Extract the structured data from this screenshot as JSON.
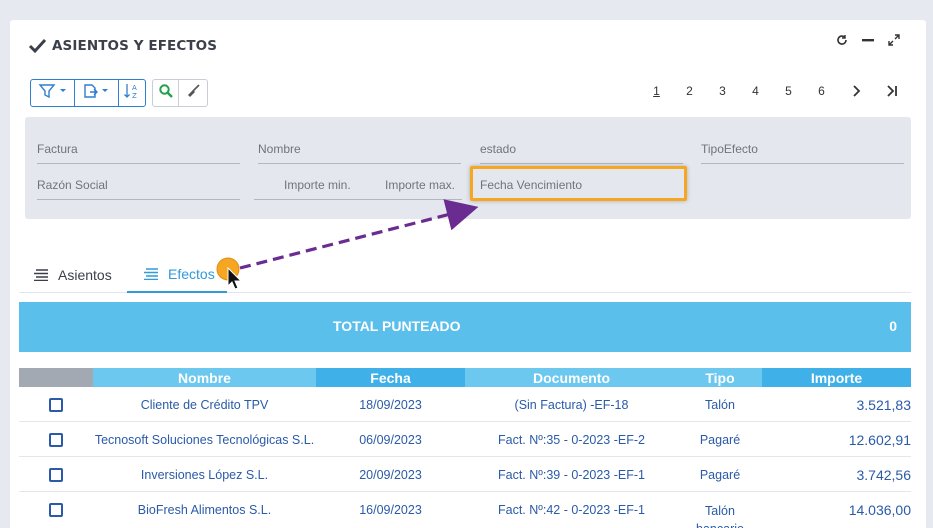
{
  "panel": {
    "title": "ASIENTOS Y EFECTOS"
  },
  "pagination": {
    "pages": [
      "1",
      "2",
      "3",
      "4",
      "5",
      "6"
    ],
    "active_page": "1"
  },
  "filters": {
    "factura": "Factura",
    "nombre": "Nombre",
    "estado": "estado",
    "tipo_efecto": "TipoEfecto",
    "razon_social": "Razón Social",
    "importe_min": "Importe min.",
    "importe_max": "Importe max.",
    "fecha_vencimiento": "Fecha Vencimiento"
  },
  "tabs": [
    {
      "label": "Asientos",
      "active": false
    },
    {
      "label": "Efectos",
      "active": true
    }
  ],
  "total": {
    "label": "TOTAL PUNTEADO",
    "value": "0"
  },
  "table": {
    "columns": [
      "",
      "Nombre",
      "Fecha",
      "Documento",
      "Tipo",
      "Importe"
    ],
    "rows": [
      {
        "nombre": "Cliente de Crédito TPV",
        "fecha": "18/09/2023",
        "documento": "(Sin Factura) -EF-18",
        "tipo": "Talón",
        "importe": "3.521,83"
      },
      {
        "nombre": "Tecnosoft Soluciones Tecnológicas S.L.",
        "fecha": "06/09/2023",
        "documento": "Fact. Nº:35 - 0-2023 -EF-2",
        "tipo": "Pagaré",
        "importe": "12.602,91"
      },
      {
        "nombre": "Inversiones López S.L.",
        "fecha": "20/09/2023",
        "documento": "Fact. Nº:39 - 0-2023 -EF-1",
        "tipo": "Pagaré",
        "importe": "3.742,56"
      },
      {
        "nombre": "BioFresh Alimentos S.L.",
        "fecha": "16/09/2023",
        "documento": "Fact. Nº:42 - 0-2023 -EF-1",
        "tipo": "Talón bancario",
        "importe": "14.036,00"
      }
    ]
  },
  "colors": {
    "accent": "#2f9bd8",
    "total_bar": "#5bbfeb",
    "header_dark": "#3fb0e8",
    "header_light": "#6cc8ef",
    "header_gray": "#a3a9b3",
    "highlight": "#f5a623",
    "annotation_arrow": "#6a2c91"
  },
  "icons": {
    "title": "check-icon",
    "refresh": "refresh-icon",
    "minimize": "minimize-icon",
    "expand": "expand-icon",
    "filter": "filter-icon",
    "export": "export-icon",
    "sort": "sort-icon",
    "search": "search-icon",
    "clear": "broom-icon",
    "next": "chevron-right-icon",
    "last": "last-page-icon",
    "tab_list": "list-icon"
  }
}
